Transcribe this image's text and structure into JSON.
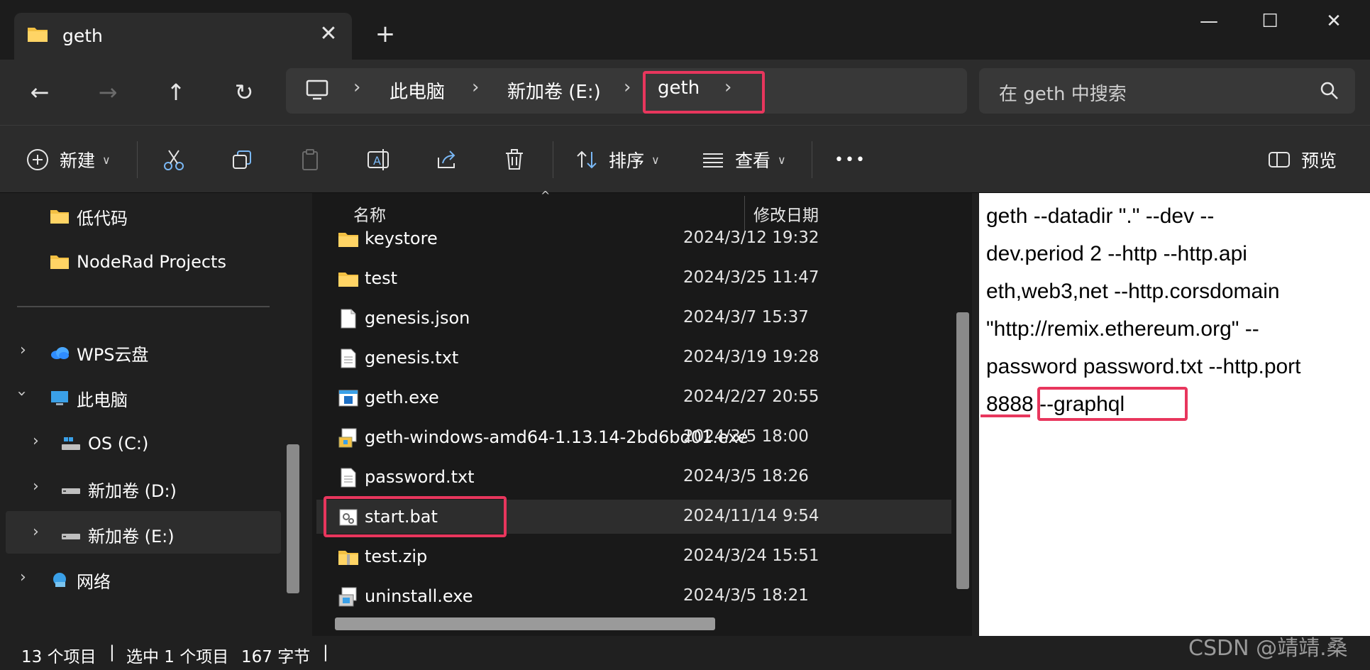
{
  "tab": {
    "title": "geth",
    "close_icon": "close-icon",
    "new_tab": "+"
  },
  "window_controls": {
    "minimize": "—",
    "maximize": "☐",
    "close": "✕"
  },
  "breadcrumb": [
    "此电脑",
    "新加卷 (E:)",
    "geth"
  ],
  "search": {
    "placeholder": "在 geth 中搜索"
  },
  "commands": {
    "new": "新建",
    "sort": "排序",
    "view": "查看",
    "more": "•••",
    "preview": "预览"
  },
  "sidebar": {
    "items": [
      {
        "label": "低代码",
        "icon": "folder-icon"
      },
      {
        "label": "NodeRad Projects",
        "icon": "folder-icon"
      },
      {
        "label": "WPS云盘",
        "icon": "cloud-icon"
      },
      {
        "label": "此电脑",
        "icon": "computer-icon"
      },
      {
        "label": "OS (C:)",
        "icon": "drive-icon"
      },
      {
        "label": "新加卷 (D:)",
        "icon": "drive-icon"
      },
      {
        "label": "新加卷 (E:)",
        "icon": "drive-icon"
      },
      {
        "label": "网络",
        "icon": "network-icon"
      }
    ]
  },
  "columns": {
    "name": "名称",
    "modified": "修改日期"
  },
  "files": [
    {
      "name": "keystore",
      "date": "2024/3/12 19:32",
      "icon": "folder-icon"
    },
    {
      "name": "test",
      "date": "2024/3/25 11:47",
      "icon": "folder-icon"
    },
    {
      "name": "genesis.json",
      "date": "2024/3/7 15:37",
      "icon": "file-icon"
    },
    {
      "name": "genesis.txt",
      "date": "2024/3/19 19:28",
      "icon": "text-file-icon"
    },
    {
      "name": "geth.exe",
      "date": "2024/2/27 20:55",
      "icon": "exe-icon"
    },
    {
      "name": "geth-windows-amd64-1.13.14-2bd6bd01.exe",
      "date": "2024/3/5 18:00",
      "icon": "installer-icon"
    },
    {
      "name": "password.txt",
      "date": "2024/3/5 18:26",
      "icon": "text-file-icon"
    },
    {
      "name": "start.bat",
      "date": "2024/11/14 9:54",
      "icon": "batch-file-icon"
    },
    {
      "name": "test.zip",
      "date": "2024/3/24 15:51",
      "icon": "zip-folder-icon"
    },
    {
      "name": "uninstall.exe",
      "date": "2024/3/5 18:21",
      "icon": "installer-icon"
    }
  ],
  "preview": {
    "lines": [
      "geth --datadir \".\" --dev --",
      "dev.period 2 --http --http.api",
      "eth,web3,net --http.corsdomain",
      "\"http://remix.ethereum.org\" --",
      "password password.txt --http.port",
      "8888 --graphql"
    ]
  },
  "status": {
    "count": "13 个项目",
    "selected": "选中 1 个项目",
    "size": "167 字节",
    "sep": "|"
  },
  "watermark": "CSDN @靖靖.桑",
  "colors": {
    "accent": "#e8365d",
    "folder": "#f3c043",
    "background": "#202020"
  }
}
